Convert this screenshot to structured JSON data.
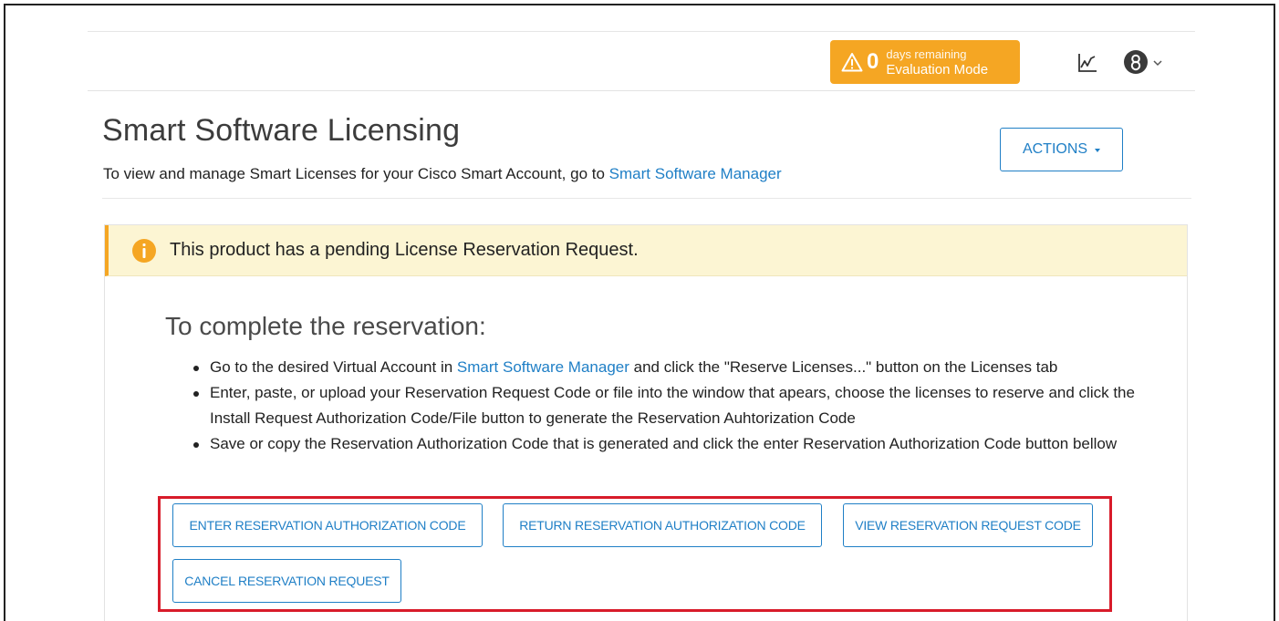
{
  "header": {
    "evaluation": {
      "count": "0",
      "days_label": "days remaining",
      "mode_label": "Evaluation Mode",
      "color": "#f5a623"
    },
    "icons": [
      "warning-icon",
      "chart-icon",
      "user-icon",
      "chevron-down-icon"
    ]
  },
  "page": {
    "title": "Smart Software Licensing",
    "subtitle_prefix": "To view and manage Smart Licenses for your Cisco Smart Account, go to",
    "subtitle_link": "Smart Software Manager",
    "actions_label": "ACTIONS"
  },
  "alert": {
    "text": "This product has a pending License Reservation Request.",
    "icon": "info-icon",
    "color": "#f5a623"
  },
  "steps": {
    "title": "To complete the reservation:",
    "items": [
      {
        "prefix": "Go to the desired Virtual Account in",
        "link": "Smart Software Manager",
        "suffix": "and click the \"Reserve Licenses...\" button on the Licenses tab"
      },
      {
        "text": "Enter, paste, or upload your Reservation Request Code or file into the window that apears, choose the licenses to reserve and click the Install Request Authorization Code/File button to generate the Reservation Auhtorization Code"
      },
      {
        "text": "Save or copy the Reservation Authorization Code that is generated and click the enter Reservation Authorization Code button bellow"
      }
    ]
  },
  "buttons": {
    "enter_code": "ENTER RESERVATION AUTHORIZATION CODE",
    "return_code": "RETURN RESERVATION AUTHORIZATION CODE",
    "view_request": "VIEW RESERVATION REQUEST CODE",
    "cancel_request": "CANCEL RESERVATION REQUEST"
  },
  "colors": {
    "link": "#1f7fc6",
    "highlight_border": "#d81b2a",
    "alert_background": "#fcf5d3"
  }
}
